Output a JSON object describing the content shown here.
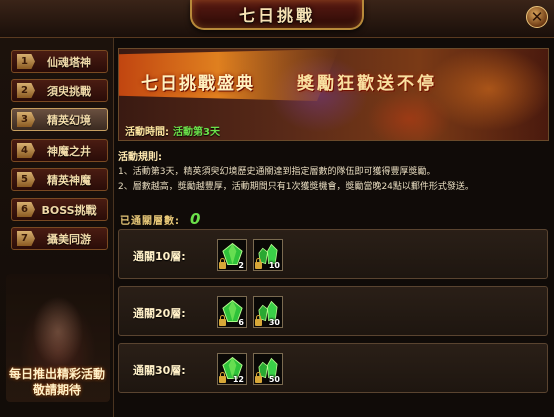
{
  "window": {
    "title": "七日挑戰"
  },
  "sidebar": {
    "items": [
      {
        "num": "1",
        "label": "仙魂塔神"
      },
      {
        "num": "2",
        "label": "須臾挑戰"
      },
      {
        "num": "3",
        "label": "精英幻境"
      },
      {
        "num": "4",
        "label": "神魔之井"
      },
      {
        "num": "5",
        "label": "精英神魔"
      },
      {
        "num": "6",
        "label": "BOSS挑戰"
      },
      {
        "num": "7",
        "label": "攝美同游"
      }
    ],
    "active_index": 2,
    "promo_line1": "每日推出精彩活動",
    "promo_line2": "敬請期待"
  },
  "banner": {
    "title": "七日挑戰盛典",
    "slogan": "獎勵狂歡送不停",
    "time_label": "活動時間:",
    "time_value": "活動第3天"
  },
  "rules": {
    "title": "活動規則:",
    "line1": "1、活動第3天，精英須臾幻境歷史通關達到指定層數的隊伍即可獲得豐厚獎勵。",
    "line2": "2、層數越高，獎勵越豐厚，活動期間只有1次獲獎機會，獎勵當晚24點以郵件形式發送。"
  },
  "progress": {
    "label": "已通關層數:",
    "count": "0"
  },
  "tiers": [
    {
      "label": "通關10層:",
      "rewards": [
        {
          "icon": "green-gem-large-icon",
          "qty": "2"
        },
        {
          "icon": "green-gem-cluster-icon",
          "qty": "10"
        }
      ]
    },
    {
      "label": "通關20層:",
      "rewards": [
        {
          "icon": "green-gem-large-icon",
          "qty": "6"
        },
        {
          "icon": "green-gem-cluster-icon",
          "qty": "30"
        }
      ]
    },
    {
      "label": "通關30層:",
      "rewards": [
        {
          "icon": "green-gem-large-icon",
          "qty": "12"
        },
        {
          "icon": "green-gem-cluster-icon",
          "qty": "50"
        }
      ]
    }
  ],
  "colors": {
    "accent_green": "#6be04a",
    "gold": "#e8c878",
    "frame": "#7a4a22"
  }
}
